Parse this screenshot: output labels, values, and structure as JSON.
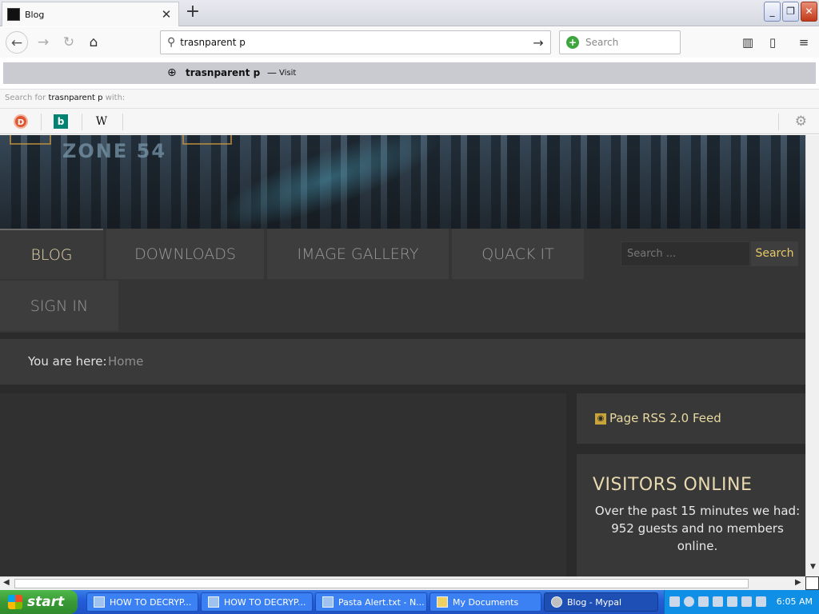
{
  "browser": {
    "tab_title": "Blog",
    "url_text": "trasnparent p",
    "search_placeholder": "Search",
    "window_buttons": [
      "_",
      "❐",
      "✕"
    ]
  },
  "autocomplete": {
    "suggestion": "trasnparent p",
    "dash": "—",
    "action": "Visit",
    "search_for_prefix": "Search for",
    "search_for_query": "trasnparent p",
    "search_for_suffix": "with:",
    "engines": [
      "duckduckgo",
      "bing",
      "wikipedia"
    ]
  },
  "site": {
    "banner_text": "ZONE 54",
    "nav": [
      "BLOG",
      "DOWNLOADS",
      "IMAGE GALLERY",
      "QUACK IT",
      "SIGN IN"
    ],
    "search_placeholder": "Search ...",
    "search_button": "Search",
    "breadcrumb_label": "You are here:",
    "breadcrumb_home": "Home",
    "feed_link": "Page RSS 2.0 Feed",
    "visitors_title": "VISITORS ONLINE",
    "visitors_text": "Over the past 15 minutes we had: 952 guests and no members online.",
    "colors": {
      "accent": "#e8d9b0",
      "link": "#e8c866",
      "background": "#2b2b2b"
    }
  },
  "taskbar": {
    "start_label": "start",
    "buttons": [
      "HOW TO DECRYP...",
      "HOW TO DECRYP...",
      "Pasta Alert.txt - N...",
      "My Documents",
      "Blog - Mypal"
    ],
    "clock": "6:05 AM"
  }
}
